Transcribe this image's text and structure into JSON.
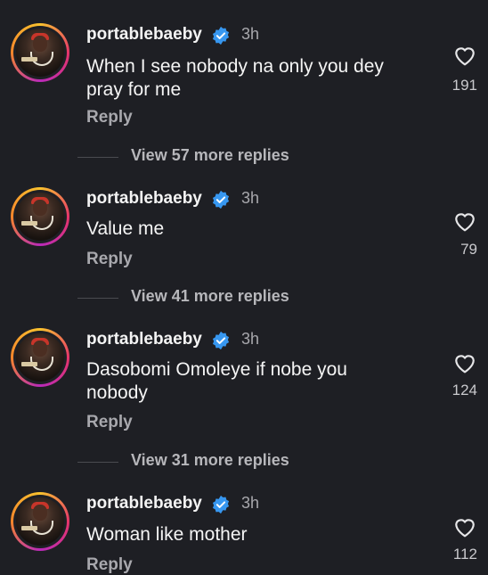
{
  "comments": [
    {
      "username": "portablebaeby",
      "time": "3h",
      "lines": [
        "When I see nobody na only you dey",
        "pray for me"
      ],
      "reply": "Reply",
      "likes": "191"
    },
    {
      "username": "portablebaeby",
      "time": "3h",
      "lines": [
        "Value me"
      ],
      "reply": "Reply",
      "likes": "79"
    },
    {
      "username": "portablebaeby",
      "time": "3h",
      "lines": [
        "Dasobomi Omoleye if nobe you",
        "nobody"
      ],
      "reply": "Reply",
      "likes": "124"
    },
    {
      "username": "portablebaeby",
      "time": "3h",
      "lines": [
        "Woman like mother"
      ],
      "reply": "Reply",
      "likes": "112"
    }
  ],
  "view_replies": [
    "View 57 more replies",
    "View 41 more replies",
    "View 31 more replies"
  ],
  "colors": {
    "background": "#1e1f24",
    "verified": "#3797f0",
    "secondary_text": "#a8a8ad"
  },
  "icons": [
    "verified-badge-icon",
    "heart-icon"
  ]
}
